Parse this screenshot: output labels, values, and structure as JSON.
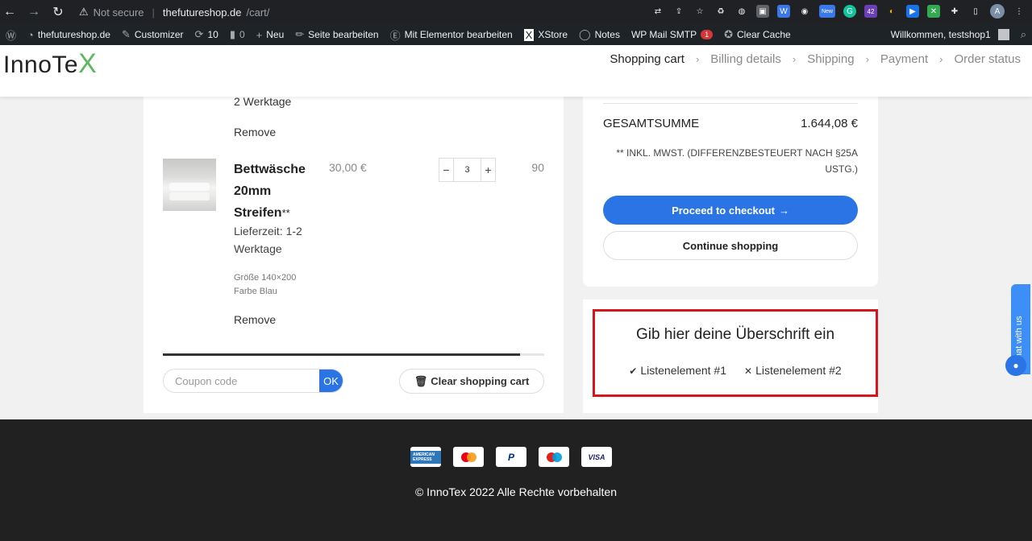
{
  "browser": {
    "security": "Not secure",
    "url_host": "thefutureshop.de",
    "url_path": "/cart/",
    "ext_new": "New",
    "ext_count": "42",
    "profile": "A"
  },
  "wpbar": {
    "site": "thefutureshop.de",
    "customizer": "Customizer",
    "updates": "10",
    "comments": "0",
    "new": "Neu",
    "edit_page": "Seite bearbeiten",
    "elementor": "Mit Elementor bearbeiten",
    "xstore": "XStore",
    "notes": "Notes",
    "wpmail": "WP Mail SMTP",
    "wpmail_badge": "1",
    "clear_cache": "Clear Cache",
    "welcome": "Willkommen, testshop1"
  },
  "header": {
    "logo_main": "InnoTe",
    "logo_accent": "X",
    "steps": [
      "Shopping cart",
      "Billing details",
      "Shipping",
      "Payment",
      "Order status"
    ]
  },
  "cart": {
    "prev_item_delivery": "2 Werktage",
    "prev_item_remove": "Remove",
    "item": {
      "title": "Bettwäsche 20mm Streifen",
      "title_suffix": "**",
      "delivery": "Lieferzeit: 1-2 Werktage",
      "attr_size": "Größe  140×200",
      "attr_color": "Farbe  Blau",
      "price": "30,00 €",
      "qty": "3",
      "subtotal": "90",
      "remove": "Remove"
    },
    "coupon_placeholder": "Coupon code",
    "coupon_ok": "OK",
    "clear_cart": "Clear shopping cart"
  },
  "totals": {
    "label": "GESAMTSUMME",
    "value": "1.644,08 €",
    "tax_note": "** INKL. MWST. (DIFFERENZBESTEUERT NACH §25A USTG.)",
    "checkout": "Proceed to checkout",
    "continue": "Continue shopping"
  },
  "widget": {
    "heading": "Gib hier deine Überschrift ein",
    "item1": "Listenelement #1",
    "item2": "Listenelement #2"
  },
  "chat": {
    "label": "Chat with us"
  },
  "footer": {
    "cards": [
      "AMERICAN EXPRESS",
      "Mastercard",
      "PayPal",
      "Maestro",
      "VISA"
    ],
    "copyright": "© InnoTex 2022 Alle Rechte vorbehalten"
  }
}
